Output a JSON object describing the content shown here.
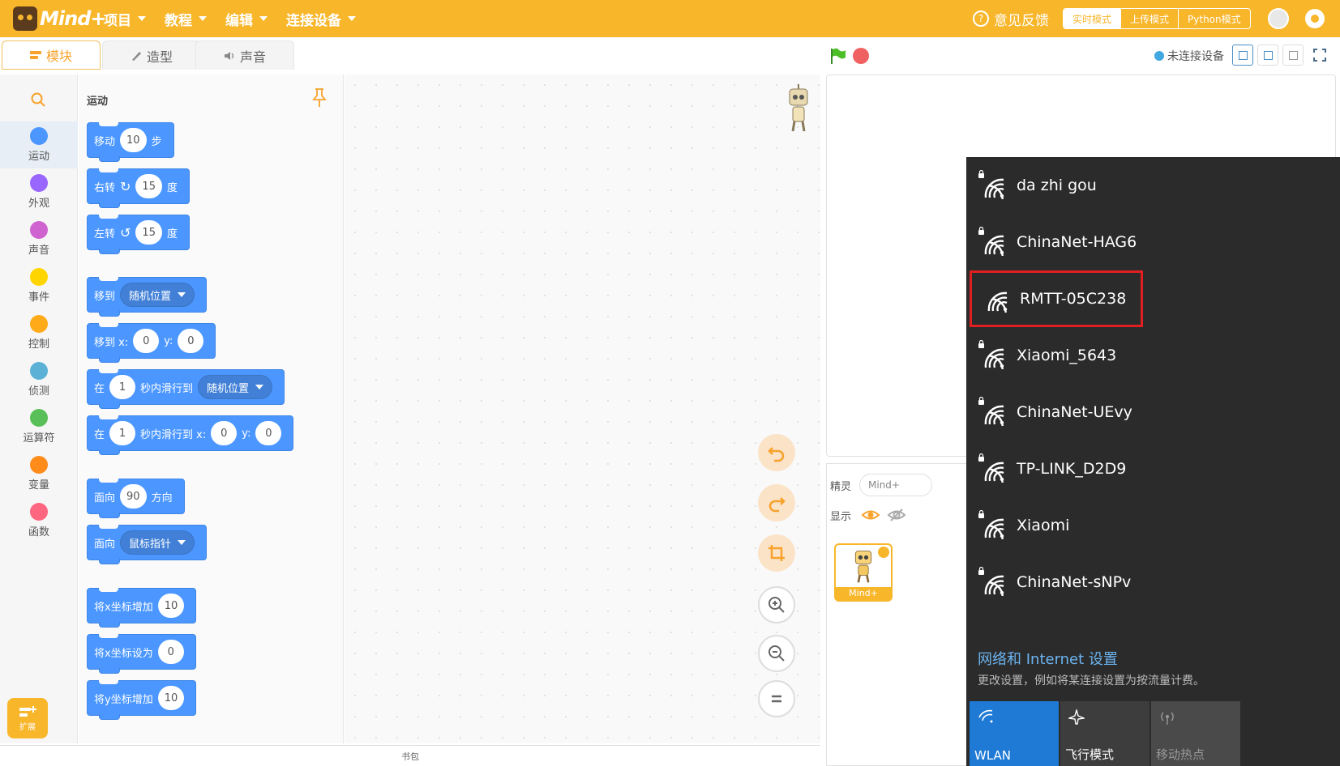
{
  "app": {
    "brand": "Mind+",
    "menu": [
      {
        "label": "项目"
      },
      {
        "label": "教程"
      },
      {
        "label": "编辑"
      },
      {
        "label": "连接设备"
      }
    ],
    "feedback": "意见反馈",
    "modes": [
      "实时模式",
      "上传模式",
      "Python模式"
    ]
  },
  "tabs": [
    {
      "label": "模块"
    },
    {
      "label": "造型"
    },
    {
      "label": "声音"
    }
  ],
  "connection_status": "未连接设备",
  "categories": [
    {
      "label": "运动",
      "color": "#4c97ff"
    },
    {
      "label": "外观",
      "color": "#9966ff"
    },
    {
      "label": "声音",
      "color": "#cf63cf"
    },
    {
      "label": "事件",
      "color": "#ffd500"
    },
    {
      "label": "控制",
      "color": "#ffab19"
    },
    {
      "label": "侦测",
      "color": "#5cb1d6"
    },
    {
      "label": "运算符",
      "color": "#59c059"
    },
    {
      "label": "变量",
      "color": "#ff8c1a"
    },
    {
      "label": "函数",
      "color": "#ff6680"
    }
  ],
  "extension_label": "扩展",
  "palette": {
    "title": "运动",
    "blocks": [
      {
        "parts": [
          "移动",
          "10",
          "步"
        ]
      },
      {
        "parts": [
          "右转",
          "15",
          "度"
        ]
      },
      {
        "parts": [
          "左转",
          "15",
          "度"
        ]
      },
      {
        "parts": [
          "移到",
          "随机位置"
        ]
      },
      {
        "parts": [
          "移到 x:",
          "0",
          "y:",
          "0"
        ]
      },
      {
        "parts": [
          "在",
          "1",
          "秒内滑行到",
          "随机位置"
        ]
      },
      {
        "parts": [
          "在",
          "1",
          "秒内滑行到 x:",
          "0",
          "y:",
          "0"
        ]
      },
      {
        "parts": [
          "面向",
          "90",
          "方向"
        ]
      },
      {
        "parts": [
          "面向",
          "鼠标指针"
        ]
      },
      {
        "parts": [
          "将x坐标增加",
          "10"
        ]
      },
      {
        "parts": [
          "将x坐标设为",
          "0"
        ]
      },
      {
        "parts": [
          "将y坐标增加",
          "10"
        ]
      }
    ]
  },
  "bag_label": "书包",
  "sprite": {
    "label": "精灵",
    "name": "Mind+",
    "show_label": "显示",
    "thumb_name": "Mind+"
  },
  "wifi": {
    "networks": [
      {
        "name": "da zhi gou",
        "secured": true
      },
      {
        "name": "ChinaNet-HAG6",
        "secured": true
      },
      {
        "name": "RMTT-05C238",
        "secured": false,
        "highlighted": true
      },
      {
        "name": "Xiaomi_5643",
        "secured": true
      },
      {
        "name": "ChinaNet-UEvy",
        "secured": true
      },
      {
        "name": "TP-LINK_D2D9",
        "secured": true
      },
      {
        "name": "Xiaomi",
        "secured": true
      },
      {
        "name": "ChinaNet-sNPv",
        "secured": true
      }
    ],
    "settings_title": "网络和 Internet 设置",
    "settings_desc": "更改设置，例如将某连接设置为按流量计费。",
    "quick_actions": [
      {
        "label": "WLAN",
        "color": "#1f7ad6",
        "icon": "wifi-icon"
      },
      {
        "label": "飞行模式",
        "color": "#3d3d3d",
        "icon": "airplane-icon"
      },
      {
        "label": "移动热点",
        "color": "#4a4a4a",
        "icon": "hotspot-icon"
      }
    ]
  }
}
